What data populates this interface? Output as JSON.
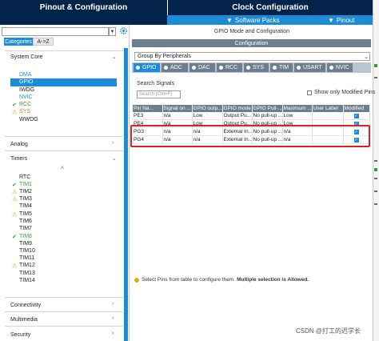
{
  "top_tabs": {
    "pinout": "Pinout & Configuration",
    "clock": "Clock Configuration"
  },
  "sub_menu": {
    "software_packs": "Software Packs",
    "pinout": "Pinout"
  },
  "left_panel": {
    "search_placeholder": "",
    "toggle_categories": "Categories",
    "toggle_az": "A->Z",
    "system_core": {
      "label": "System Core",
      "items": [
        {
          "label": "DMA",
          "status": "none"
        },
        {
          "label": "GPIO",
          "status": "selected"
        },
        {
          "label": "IWDG",
          "status": "none"
        },
        {
          "label": "NVIC",
          "status": "none"
        },
        {
          "label": "RCC",
          "status": "ok"
        },
        {
          "label": "SYS",
          "status": "warning"
        },
        {
          "label": "WWDG",
          "status": "none"
        }
      ]
    },
    "analog": "Analog",
    "timers": {
      "label": "Timers",
      "items": [
        {
          "label": "RTC",
          "status": "none"
        },
        {
          "label": "TIM1",
          "status": "ok"
        },
        {
          "label": "TIM2",
          "status": "warning"
        },
        {
          "label": "TIM3",
          "status": "warning"
        },
        {
          "label": "TIM4",
          "status": "none"
        },
        {
          "label": "TIM5",
          "status": "warning"
        },
        {
          "label": "TIM6",
          "status": "none"
        },
        {
          "label": "TIM7",
          "status": "none"
        },
        {
          "label": "TIM8",
          "status": "ok"
        },
        {
          "label": "TIM9",
          "status": "none"
        },
        {
          "label": "TIM10",
          "status": "none"
        },
        {
          "label": "TIM11",
          "status": "none"
        },
        {
          "label": "TIM12",
          "status": "warning"
        },
        {
          "label": "TIM13",
          "status": "none"
        },
        {
          "label": "TIM14",
          "status": "none"
        }
      ]
    },
    "connectivity": "Connectivity",
    "multimedia": "Multimedia",
    "security": "Security"
  },
  "main": {
    "title": "GPIO Mode and Configuration",
    "configuration": "Configuration",
    "group_by": "Group By Peripherals",
    "peripheral_tabs": [
      "GPIO",
      "ADC",
      "DAC",
      "RCC",
      "SYS",
      "TIM",
      "USART",
      "NVIC"
    ],
    "search_signals_label": "Search Signals",
    "search_signals_placeholder": "Search (Ctrl+F)",
    "show_only_modified": "Show only Modified Pins",
    "columns": [
      "Pin Na...",
      "Signal on ...",
      "GPIO outp...",
      "GPIO mode",
      "GPIO Pull-...",
      "Maximum ...",
      "User Label",
      "Modified"
    ],
    "rows": [
      [
        "PE3",
        "n/a",
        "Low",
        "Output Pu...",
        "No pull-up ...",
        "Low",
        "",
        true
      ],
      [
        "PE4",
        "n/a",
        "Low",
        "Output Pu...",
        "No pull-up ...",
        "Low",
        "",
        true
      ],
      [
        "PG3",
        "n/a",
        "n/a",
        "External In...",
        "No pull-up ...",
        "n/a",
        "",
        true
      ],
      [
        "PG4",
        "n/a",
        "n/a",
        "External In...",
        "No pull-up ...",
        "n/a",
        "",
        true
      ]
    ],
    "hint_prefix": "Select Pins from table to configure them.",
    "hint_bold": "Multiple selection is Allowed."
  },
  "watermark": "CSDN @打工的迟学长",
  "colors": {
    "navy": "#03234b",
    "accent_blue": "#1c8cd9",
    "header_gray": "#6d7f8e",
    "highlight_red": "#e02020",
    "ok_green": "#3a9a3a",
    "warn_amber": "#e0a000"
  }
}
